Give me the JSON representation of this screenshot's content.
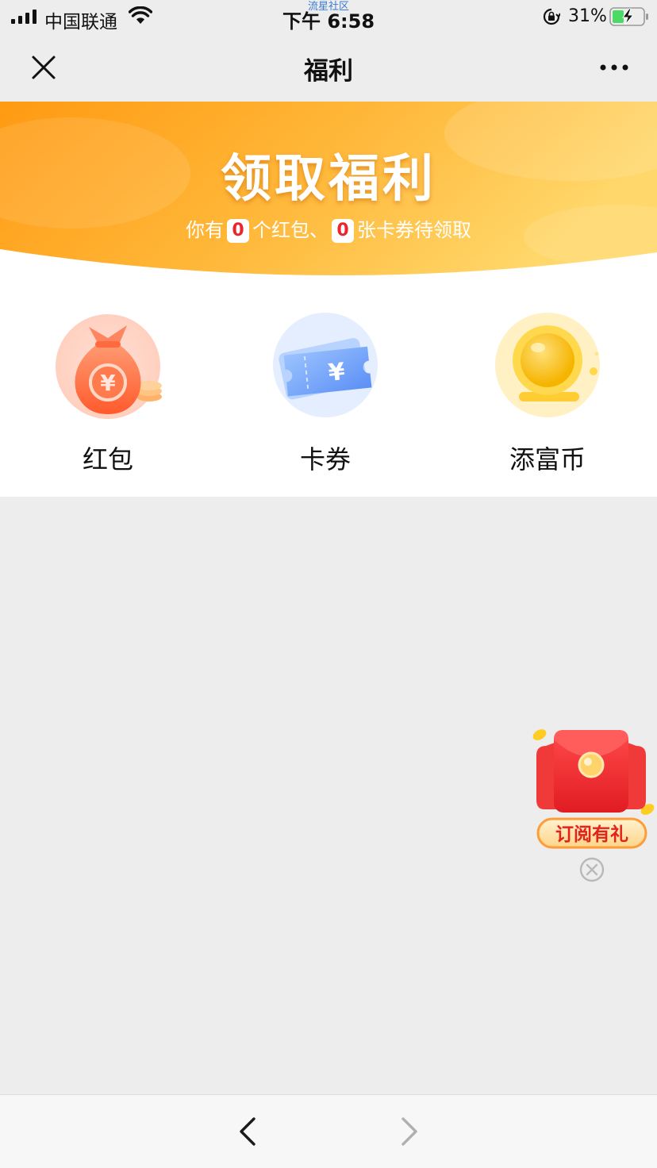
{
  "status_bar": {
    "carrier": "中国联通",
    "time": "下午 6:58",
    "watermark": "流星社区",
    "battery_percent": "31%",
    "icons": [
      "signal-icon",
      "wifi-icon",
      "rotation-lock-icon",
      "battery-charging-icon"
    ]
  },
  "nav": {
    "title": "福利",
    "close_icon": "close-icon",
    "more_icon": "more-dots-icon"
  },
  "banner": {
    "title": "领取福利",
    "subtitle_prefix": "你有",
    "red_packet_count": "0",
    "subtitle_middle": "个红包、",
    "coupon_count": "0",
    "subtitle_suffix": "张卡券待领取",
    "colors": {
      "primary": "#ff9c10",
      "secondary": "#ffd76a"
    }
  },
  "categories": [
    {
      "label": "红包",
      "icon": "money-bag-icon"
    },
    {
      "label": "卡券",
      "icon": "coupon-ticket-icon"
    },
    {
      "label": "添富币",
      "icon": "gold-coin-icon"
    }
  ],
  "floating_gift": {
    "label": "订阅有礼",
    "icon": "red-envelope-icon",
    "close_icon": "circle-close-icon"
  },
  "bottom_bar": {
    "back_icon": "chevron-left-icon",
    "forward_icon": "chevron-right-icon",
    "forward_enabled": false
  }
}
